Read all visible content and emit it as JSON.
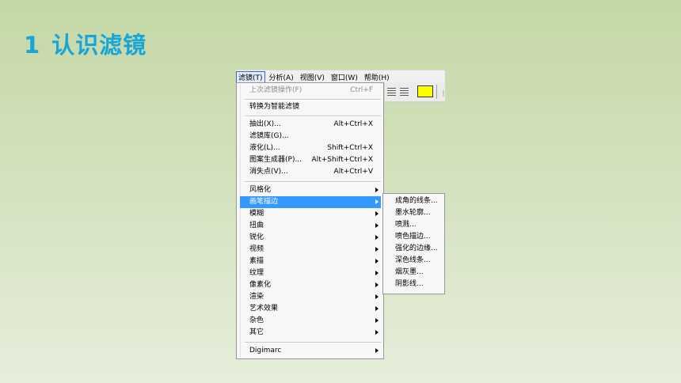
{
  "slide": {
    "title_number": "1",
    "title_text": "认识滤镜",
    "title_color": "#17a5d8"
  },
  "menubar": {
    "items": [
      "滤镜(T)",
      "分析(A)",
      "视图(V)",
      "窗口(W)",
      "帮助(H)"
    ],
    "active_index": 0
  },
  "toolbar": {
    "swatch_color": "#ffff00",
    "icons": [
      "align-center-icon",
      "align-right-icon"
    ]
  },
  "filter_menu": {
    "items": [
      {
        "label": "上次滤镜操作(F)",
        "shortcut": "Ctrl+F",
        "disabled": true
      },
      {
        "label": "转换为智能滤镜"
      },
      {
        "label": "抽出(X)...",
        "shortcut": "Alt+Ctrl+X"
      },
      {
        "label": "滤镜库(G)..."
      },
      {
        "label": "液化(L)...",
        "shortcut": "Shift+Ctrl+X"
      },
      {
        "label": "图案生成器(P)...",
        "shortcut": "Alt+Shift+Ctrl+X"
      },
      {
        "label": "消失点(V)...",
        "shortcut": "Alt+Ctrl+V"
      },
      {
        "label": "风格化",
        "submenu": true
      },
      {
        "label": "画笔描边",
        "submenu": true,
        "highlighted": true
      },
      {
        "label": "模糊",
        "submenu": true
      },
      {
        "label": "扭曲",
        "submenu": true
      },
      {
        "label": "锐化",
        "submenu": true
      },
      {
        "label": "视频",
        "submenu": true
      },
      {
        "label": "素描",
        "submenu": true
      },
      {
        "label": "纹理",
        "submenu": true
      },
      {
        "label": "像素化",
        "submenu": true
      },
      {
        "label": "渲染",
        "submenu": true
      },
      {
        "label": "艺术效果",
        "submenu": true
      },
      {
        "label": "杂色",
        "submenu": true
      },
      {
        "label": "其它",
        "submenu": true
      },
      {
        "label": "Digimarc",
        "submenu": true
      }
    ],
    "highlight_color": "#3399ff"
  },
  "brush_strokes_submenu": {
    "items": [
      "成角的线条...",
      "墨水轮廓...",
      "喷溅...",
      "喷色描边...",
      "强化的边缘...",
      "深色线条...",
      "烟灰墨...",
      "阴影线..."
    ]
  }
}
